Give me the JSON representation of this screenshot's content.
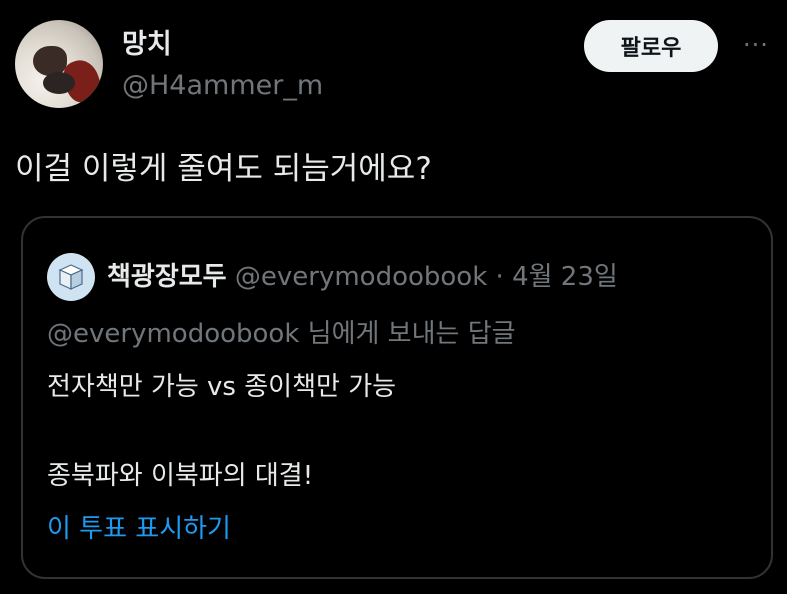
{
  "author": {
    "display_name": "망치",
    "handle": "@H4ammer_m"
  },
  "actions": {
    "follow_label": "팔로우",
    "more_label": "···"
  },
  "tweet": {
    "text": "이걸 이렇게 줄여도 되늠거에요?"
  },
  "quoted": {
    "display_name": "책광장모두",
    "handle": "@everymodoobook",
    "separator": "·",
    "date": "4월 23일",
    "reply_to": "@everymodoobook 님에게 보내는 답글",
    "line1": "전자책만 가능 vs 종이책만 가능",
    "line2": "종북파와 이북파의 대결!",
    "poll_link": "이 투표 표시하기"
  },
  "colors": {
    "background": "#000000",
    "text_primary": "#e7e9ea",
    "text_secondary": "#71767b",
    "link": "#1d9bf0",
    "border": "#2f3336",
    "follow_button_bg": "#eff3f4"
  },
  "icons": {
    "avatar": "profile-photo",
    "quoted_avatar": "book-logo-icon",
    "more": "more-options-icon"
  }
}
